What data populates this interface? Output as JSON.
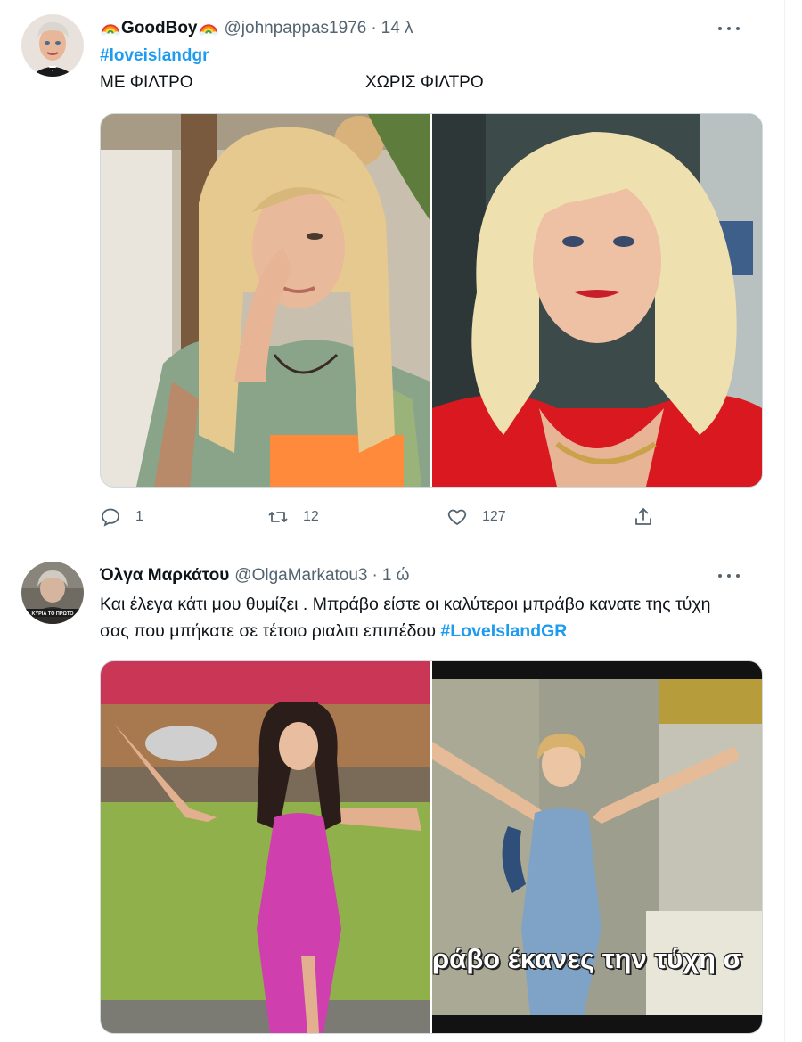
{
  "tweets": [
    {
      "display_name": "GoodBoy",
      "handle": "@johnpappas1976",
      "separator": "·",
      "time": "14 λ",
      "hashtag": "#loveislandgr",
      "caption_left": "ΜΕ ΦΙΛΤΡΟ",
      "caption_right": "ΧΩΡΙΣ ΦΙΛΤΡΟ",
      "replies": "1",
      "retweets": "12",
      "likes": "127"
    },
    {
      "display_name": "Όλγα Μαρκάτου",
      "handle": "@OlgaMarkatou3",
      "separator": "·",
      "time": "1 ώ",
      "text": "Και έλεγα κάτι μου θυμίζει . Μπράβο είστε οι καλύτεροι μπράβο κανατε της τύχη σας που μπήκατε σε τέτοιο ριαλιτι επιπέδου ",
      "hashtag": "#LoveIslandGR",
      "avatar_caption": "ΚΥΡΙΑ ΤΟ ΠΡΩΤΟ",
      "video_subtitle": "ράβο έκανες την τύχη σ"
    }
  ],
  "icons": {
    "reply": "reply-icon",
    "retweet": "retweet-icon",
    "like": "heart-icon",
    "share": "share-icon",
    "more": "more-icon",
    "emoji": "rainbow-emoji-icon"
  },
  "colors": {
    "link": "#1d9bf0",
    "secondary": "#536471",
    "border": "#cfd9de"
  }
}
